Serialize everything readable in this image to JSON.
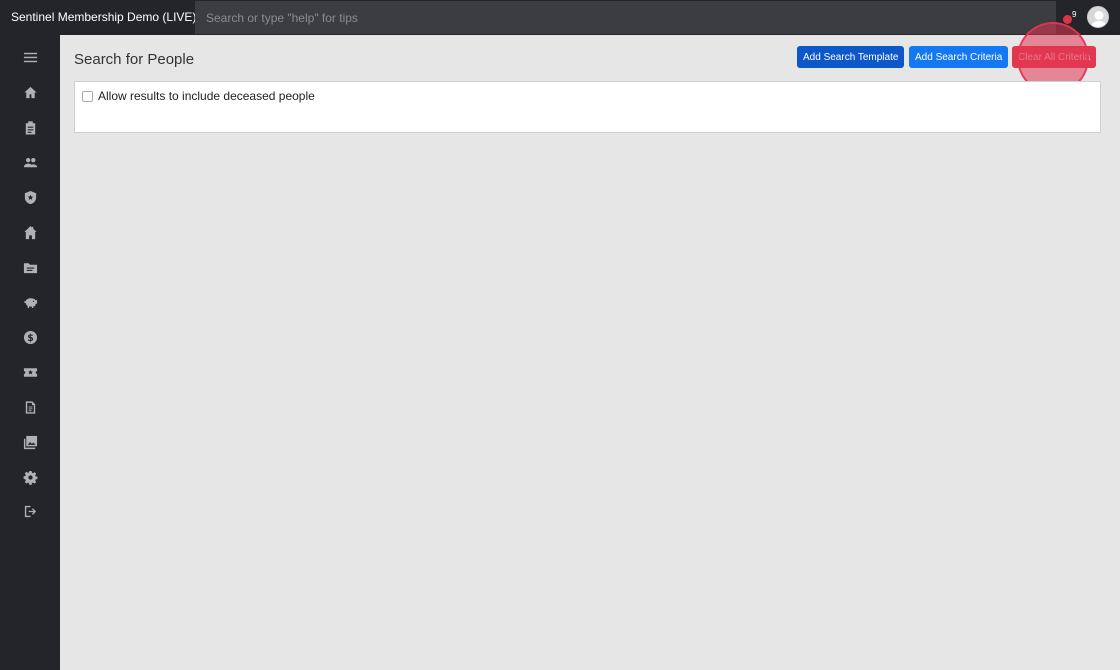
{
  "header": {
    "title": "Sentinel Membership Demo (LIVE)",
    "search_placeholder": "Search or type \"help\" for tips",
    "notification_count": "9"
  },
  "sidebar": {
    "items": [
      {
        "icon": "menu-icon"
      },
      {
        "icon": "home-icon"
      },
      {
        "icon": "clipboard-icon"
      },
      {
        "icon": "people-icon"
      },
      {
        "icon": "shield-icon"
      },
      {
        "icon": "building-icon"
      },
      {
        "icon": "folder-icon"
      },
      {
        "icon": "piggy-bank-icon"
      },
      {
        "icon": "dollar-icon"
      },
      {
        "icon": "ticket-icon"
      },
      {
        "icon": "document-icon"
      },
      {
        "icon": "photo-library-icon"
      },
      {
        "icon": "gear-icon"
      },
      {
        "icon": "logout-icon"
      }
    ]
  },
  "main": {
    "title": "Search for People",
    "buttons": {
      "add_template": "Add Search Template",
      "add_criteria": "Add Search Criteria",
      "clear_all": "Clear All Criteria"
    },
    "deceased_option": "Allow results to include deceased people"
  },
  "colors": {
    "topbar": "#232529",
    "primary_dark": "#0d57c9",
    "primary": "#1479f0",
    "danger": "#e0394f"
  }
}
